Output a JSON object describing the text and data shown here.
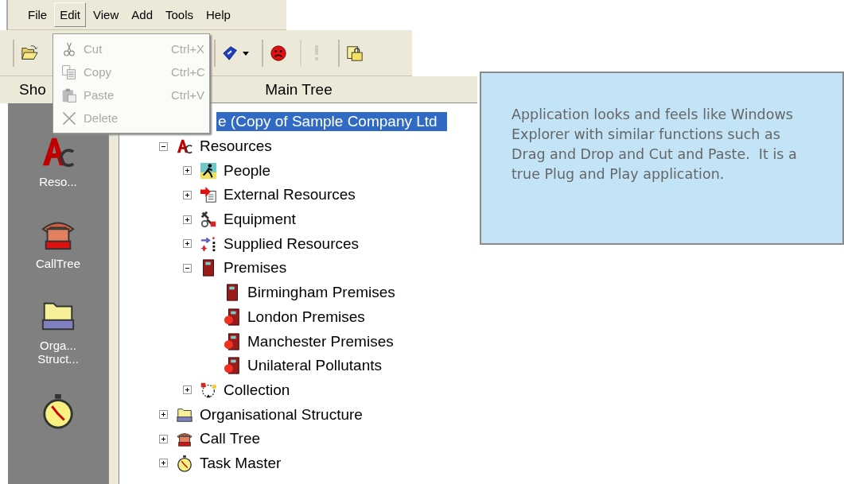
{
  "menu_bar": [
    {
      "label": "File",
      "selected": false
    },
    {
      "label": "Edit",
      "selected": true
    },
    {
      "label": "View",
      "selected": false
    },
    {
      "label": "Add",
      "selected": false
    },
    {
      "label": "Tools",
      "selected": false
    },
    {
      "label": "Help",
      "selected": false
    }
  ],
  "edit_menu": [
    {
      "kind": "cut",
      "label": "Cut",
      "shortcut": "Ctrl+X",
      "disabled": true
    },
    {
      "kind": "copy",
      "label": "Copy",
      "shortcut": "Ctrl+C",
      "disabled": true
    },
    {
      "kind": "paste",
      "label": "Paste",
      "shortcut": "Ctrl+V",
      "disabled": true
    },
    {
      "kind": "delete",
      "label": "Delete",
      "disabled": true
    }
  ],
  "toolbar": [
    {
      "kind": "open-folder",
      "disabled": false
    },
    {
      "kind": "hidden"
    },
    {
      "kind": "tag",
      "disabled": false
    },
    {
      "kind": "sad-face",
      "disabled": false
    },
    {
      "kind": "exclamation",
      "disabled": true
    },
    {
      "kind": "lock-folder",
      "disabled": false
    }
  ],
  "shortcut_bar": {
    "header": "Sho",
    "items": [
      {
        "kind": "resources",
        "label": "Reso..."
      },
      {
        "kind": "phone",
        "label": "CallTree"
      },
      {
        "kind": "folder",
        "label": "Orga... Struct..."
      },
      {
        "kind": "stopwatch"
      }
    ]
  },
  "main_tree": {
    "header": "Main Tree",
    "root": {
      "label": "e (Copy of Sample Company Ltd",
      "selected": true,
      "children": [
        {
          "kind": "resources",
          "label": "Resources",
          "expanded": true,
          "selected": false,
          "children": [
            {
              "kind": "person",
              "label": "People",
              "expanded": false,
              "selected": false
            },
            {
              "kind": "import",
              "label": "External Resources",
              "expanded": false,
              "selected": false
            },
            {
              "kind": "tools",
              "label": "Equipment",
              "expanded": false,
              "selected": false
            },
            {
              "kind": "supply",
              "label": "Supplied Resources",
              "expanded": false,
              "selected": false
            },
            {
              "kind": "door",
              "label": "Premises",
              "expanded": true,
              "selected": false,
              "children": [
                {
                  "kind": "door",
                  "label": "Birmingham Premises",
                  "selected": false
                },
                {
                  "kind": "door-alert",
                  "label": "London Premises",
                  "selected": false
                },
                {
                  "kind": "door-alert",
                  "label": "Manchester Premises",
                  "selected": false
                },
                {
                  "kind": "door-alert",
                  "label": "Unilateral Pollutants",
                  "selected": false
                }
              ]
            },
            {
              "kind": "collection",
              "label": "Collection",
              "expanded": false,
              "selected": false
            }
          ]
        },
        {
          "kind": "folder",
          "label": "Organisational Structure",
          "expanded": false,
          "selected": false
        },
        {
          "kind": "phone",
          "label": "Call Tree",
          "expanded": false,
          "selected": false
        },
        {
          "kind": "stopwatch",
          "label": "Task Master",
          "expanded": false,
          "selected": false
        }
      ]
    }
  },
  "callout": {
    "text": "Application looks and feels like Windows Explorer with similar functions such as Drag and Drop and Cut and Paste.  It is a true Plug and Play application."
  }
}
